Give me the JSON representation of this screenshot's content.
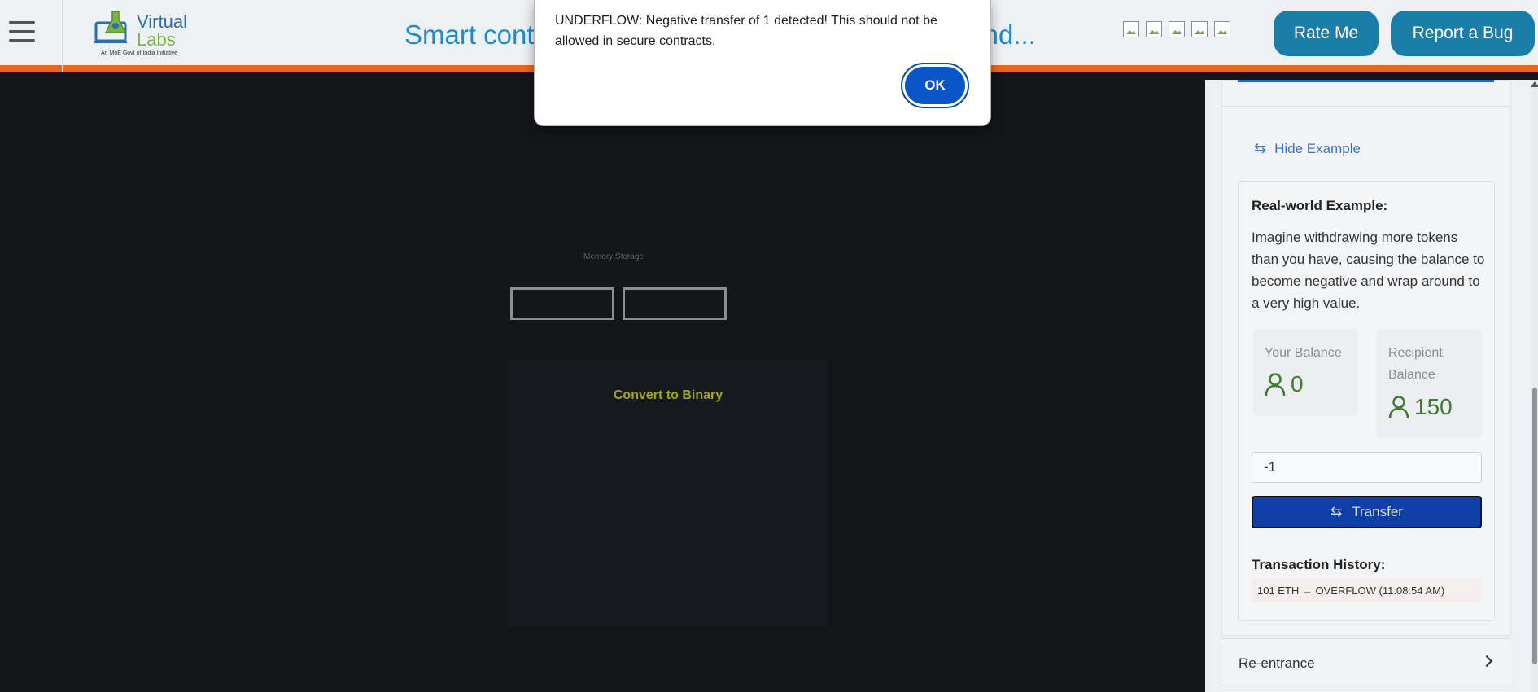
{
  "header": {
    "logo": {
      "line1": "Virtual",
      "line2": "Labs",
      "tagline": "An MoE Govt of India Initiative"
    },
    "title": "Smart contract vulnerabilities: Integer Overflow and...",
    "rate_label": "Rate Me",
    "bug_label": "Report a Bug",
    "broken_images": [
      "img",
      "img",
      "img",
      "img",
      "img"
    ]
  },
  "main": {
    "memory_label": "Memory Storage",
    "convert_label": "Convert to Binary"
  },
  "sidebar": {
    "hide_example_label": "Hide Example",
    "example_title": "Real-world Example:",
    "example_desc": "Imagine withdrawing more tokens than you have, causing the balance to become negative and wrap around to a very high value.",
    "your_balance_label": "Your Balance",
    "your_balance_value": "0",
    "recipient_balance_label": "Recipient Balance",
    "recipient_balance_value": "150",
    "amount_value": "-1",
    "transfer_label": "Transfer",
    "tx_history_title": "Transaction History:",
    "tx_history": [
      "101 ETH → OVERFLOW (11:08:54 AM)"
    ],
    "next_section_label": "Re-entrance"
  },
  "dialog": {
    "message": "UNDERFLOW: Negative transfer of 1 detected! This should not be allowed in secure contracts.",
    "ok_label": "OK"
  },
  "colors": {
    "header_accent": "#e8671f",
    "title_blue": "#1f8cc4",
    "button_teal": "#1a7ea9",
    "balance_green": "#3e7d2c",
    "transfer_blue": "#0e3fa6",
    "binary_text": "#a7a319"
  },
  "icons": {
    "menu": "hamburger-icon",
    "swap": "swap-arrows-icon",
    "person": "person-icon",
    "chevron": "chevron-right-icon"
  }
}
